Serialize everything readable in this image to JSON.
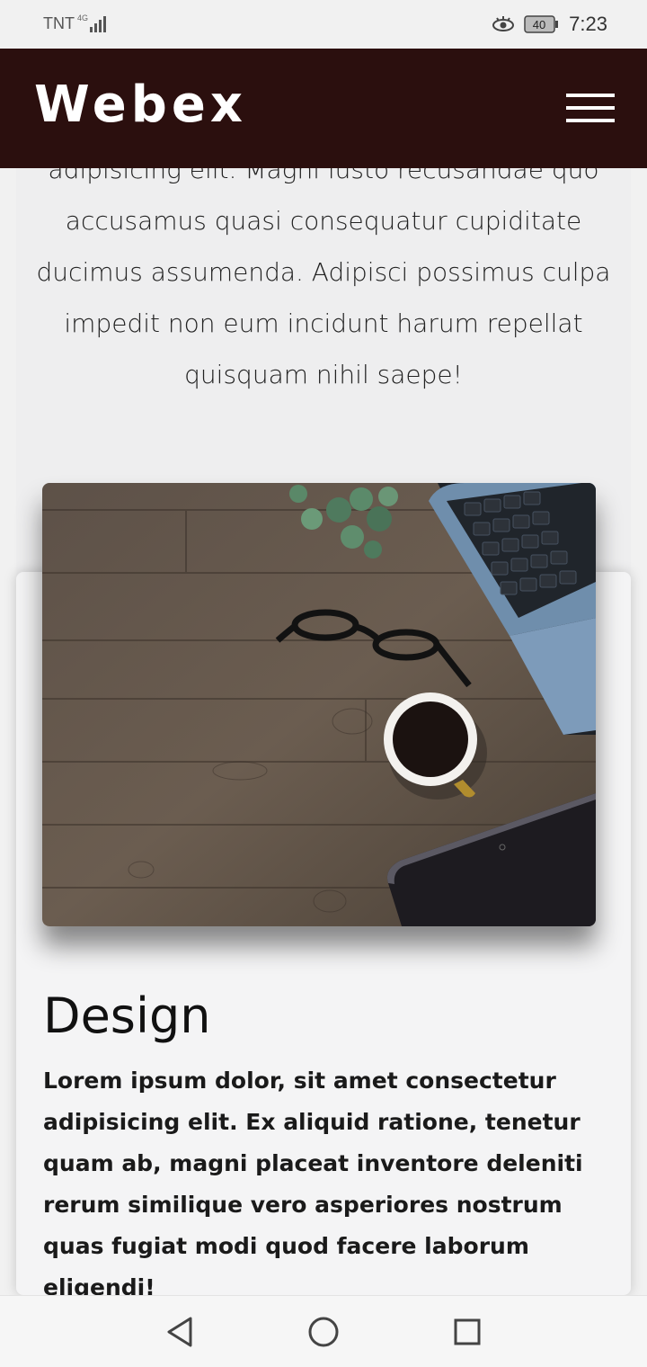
{
  "status_bar": {
    "carrier": "TNT",
    "network": "4G",
    "battery": "40",
    "time": "7:23"
  },
  "header": {
    "brand": "Webex",
    "menu_icon": "hamburger-menu-icon"
  },
  "intro": {
    "text": "adipisicing elit. Magni iusto recusandae quo accusamus quasi consequatur cupiditate ducimus assumenda. Adipisci possimus culpa impedit non eum incidunt harum repellat quisquam nihil saepe!"
  },
  "design_card": {
    "image_subject": "desk-with-laptop-coffee-glasses-plant",
    "title": "Design",
    "body": "Lorem ipsum dolor, sit amet consectetur adipisicing elit. Ex aliquid ratione, tenetur quam ab, magni placeat inventore deleniti rerum similique vero asperiores nostrum quas fugiat modi quod facere laborum eligendi!"
  },
  "nav_bar": {
    "back_icon": "back-triangle-icon",
    "home_icon": "home-circle-icon",
    "recents_icon": "recents-square-icon"
  },
  "colors": {
    "header_bg": "#2b0f0e",
    "page_bg": "#f1f1f1",
    "card_bg": "#f4f4f5"
  }
}
